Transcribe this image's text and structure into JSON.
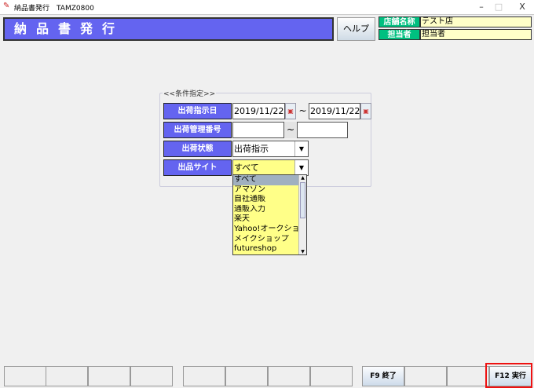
{
  "window": {
    "title": "納品書発行　TAMZ0800",
    "minimize": "–",
    "maximize": "□",
    "close": "X"
  },
  "header": {
    "title": "納品書発行",
    "help_label": "ヘルプ",
    "shop_label": "店舗名称",
    "shop_value": "テスト店",
    "person_label": "担当者",
    "person_value": "担当者"
  },
  "form": {
    "legend": "<<条件指定>>",
    "ship_date": {
      "label": "出荷指示日",
      "from": "2019/11/22",
      "to": "2019/11/22",
      "sep": "~"
    },
    "ship_no": {
      "label": "出荷管理番号",
      "from": "",
      "to": "",
      "sep": "~"
    },
    "ship_status": {
      "label": "出荷状態",
      "value": "出荷指示"
    },
    "site": {
      "label": "出品サイト",
      "value": "すべて",
      "options": [
        "すべて",
        "アマゾン",
        "自社通販",
        "通販入力",
        "楽天",
        "Yahoo!オークション",
        "メイクショップ",
        "futureshop"
      ]
    }
  },
  "function_keys": [
    "",
    "",
    "",
    "",
    "",
    "",
    "",
    "",
    "F9 終了",
    "",
    "",
    "F12 実行"
  ],
  "colors": {
    "header": "#6464f0",
    "label_green": "#00c080",
    "field_yellow": "#ffffc8",
    "highlight": "#ee1111"
  }
}
